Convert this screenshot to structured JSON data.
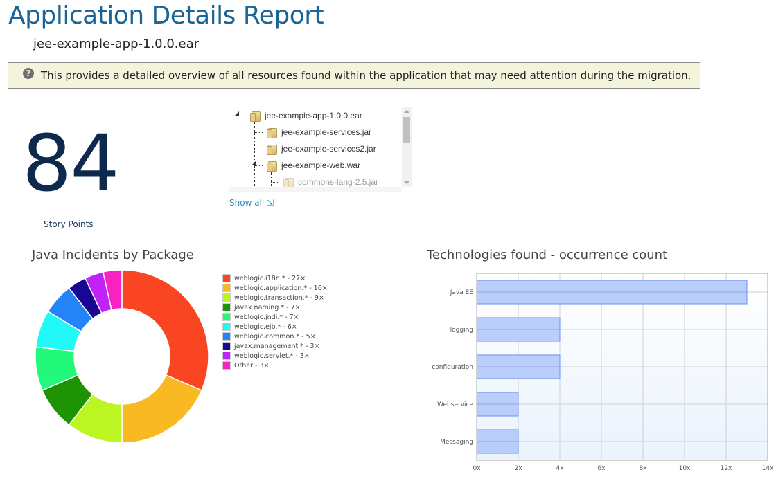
{
  "header": {
    "title": "Application Details Report",
    "app_name": "jee-example-app-1.0.0.ear"
  },
  "info": {
    "icon": "question-circle-icon",
    "text": "This provides a detailed overview of all resources found within the application that may need attention during the migration."
  },
  "story_points": {
    "value": "84",
    "label": "Story Points"
  },
  "tree": {
    "items": [
      {
        "label": "jee-example-app-1.0.0.ear",
        "level": 0,
        "expanded": true,
        "dim": false
      },
      {
        "label": "jee-example-services.jar",
        "level": 1,
        "expanded": false,
        "dim": false
      },
      {
        "label": "jee-example-services2.jar",
        "level": 1,
        "expanded": false,
        "dim": false
      },
      {
        "label": "jee-example-web.war",
        "level": 1,
        "expanded": true,
        "dim": false
      },
      {
        "label": "commons-lang-2.5.jar",
        "level": 2,
        "expanded": false,
        "dim": true
      }
    ],
    "show_all_label": "Show all ⇲"
  },
  "chart_data": [
    {
      "type": "pie",
      "title": "Java Incidents by Package",
      "legend_position": "right",
      "donut": true,
      "slices": [
        {
          "label": "weblogic.i18n.*",
          "value": 27,
          "color": "#f94522"
        },
        {
          "label": "weblogic.application.*",
          "value": 16,
          "color": "#f8b923"
        },
        {
          "label": "weblogic.transaction.*",
          "value": 9,
          "color": "#bbf622"
        },
        {
          "label": "javax.naming.*",
          "value": 7,
          "color": "#1e9304"
        },
        {
          "label": "weblogic.jndi.*",
          "value": 7,
          "color": "#22f87a"
        },
        {
          "label": "weblogic.ejb.*",
          "value": 6,
          "color": "#22f8f8"
        },
        {
          "label": "weblogic.common.*",
          "value": 5,
          "color": "#2384f8"
        },
        {
          "label": "javax.management.*",
          "value": 3,
          "color": "#180793"
        },
        {
          "label": "weblogic.servlet.*",
          "value": 3,
          "color": "#c022f8"
        },
        {
          "label": "Other",
          "value": 3,
          "color": "#f822c0"
        }
      ]
    },
    {
      "type": "bar",
      "orientation": "horizontal",
      "title": "Technologies found - occurrence count",
      "categories": [
        "Java EE",
        "logging",
        "configuration",
        "Webservice",
        "Messaging"
      ],
      "values": [
        13,
        4,
        4,
        2,
        2
      ],
      "xlabel": "",
      "ylabel": "",
      "xlim": [
        0,
        14
      ],
      "xticks": [
        "0x",
        "2x",
        "4x",
        "6x",
        "8x",
        "10x",
        "12x",
        "14x"
      ],
      "grid": true,
      "bar_color": "#b3c9fb",
      "bar_border": "#6a8ef0"
    }
  ]
}
